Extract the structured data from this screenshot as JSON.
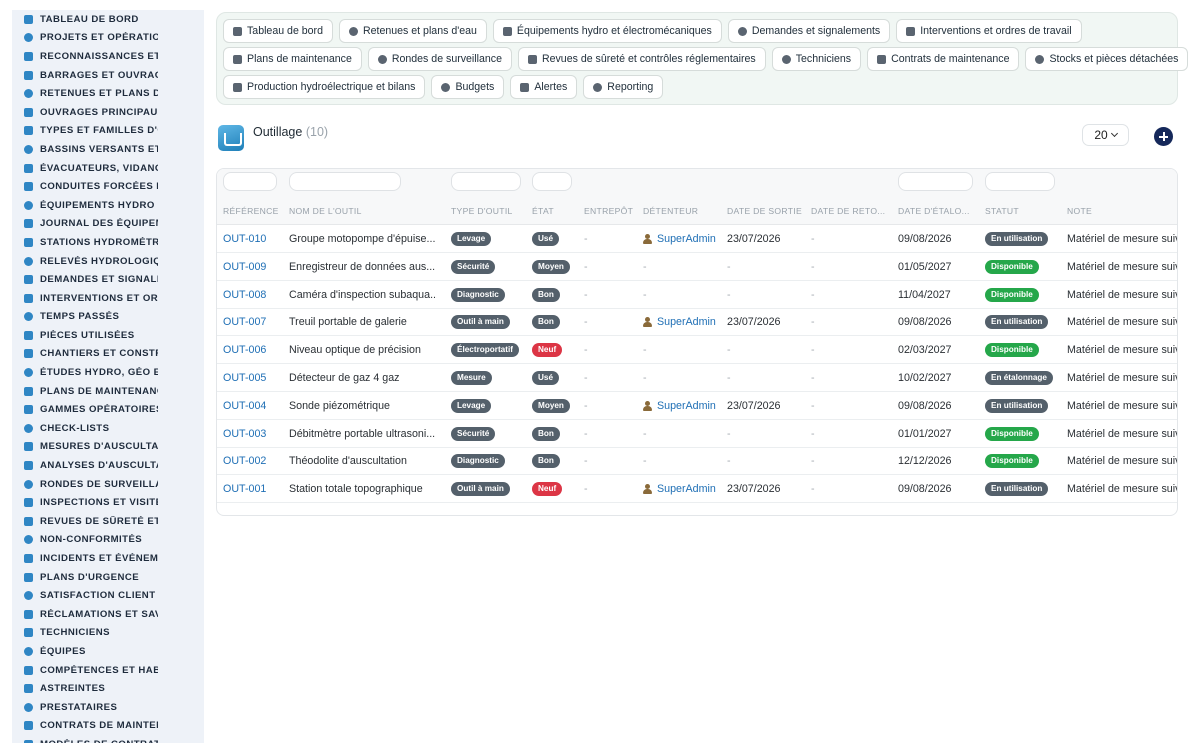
{
  "colors": {
    "sidebar_bg": "#eef2f8",
    "accent": "#2f86c4",
    "link": "#1f6fb5",
    "pill_dark": "#54606b",
    "pill_green": "#25a74a",
    "pill_red": "#dc3545",
    "add_button": "#15285a"
  },
  "sidebar": {
    "items": [
      {
        "label": "TABLEAU DE BORD",
        "icon": "dashboard-icon"
      },
      {
        "label": "PROJETS ET OPÉRATION",
        "icon": "target-icon"
      },
      {
        "label": "RECONNAISSANCES ET V",
        "icon": "ruler-icon"
      },
      {
        "label": "BARRAGES ET OUVRAGE",
        "icon": "dam-icon"
      },
      {
        "label": "RETENUES ET PLANS D'E",
        "icon": "document-icon"
      },
      {
        "label": "OUVRAGES PRINCIPAUX",
        "icon": "building-icon"
      },
      {
        "label": "TYPES ET FAMILLES D'OU",
        "icon": "sitemap-icon"
      },
      {
        "label": "BASSINS VERSANTS ET A",
        "icon": "grid-icon"
      },
      {
        "label": "ÉVACUATEURS, VIDANGE",
        "icon": "grid-icon"
      },
      {
        "label": "CONDUITES FORCÉES ET",
        "icon": "pipe-icon"
      },
      {
        "label": "ÉQUIPEMENTS HYDRO ET",
        "icon": "cogs-icon"
      },
      {
        "label": "JOURNAL DES ÉQUIPEME",
        "icon": "history-icon"
      },
      {
        "label": "STATIONS HYDROMÉTRIC",
        "icon": "gauge-icon"
      },
      {
        "label": "RELEVÉS HYDROLOGIQU",
        "icon": "table-icon"
      },
      {
        "label": "DEMANDES ET SIGNALEM",
        "icon": "help-icon"
      },
      {
        "label": "INTERVENTIONS ET ORDI",
        "icon": "clipboard-icon"
      },
      {
        "label": "TEMPS PASSÉS",
        "icon": "clock-icon"
      },
      {
        "label": "PIÈCES UTILISÉES",
        "icon": "boxes-icon"
      },
      {
        "label": "CHANTIERS ET CONSTRU",
        "icon": "hammer-icon"
      },
      {
        "label": "ÉTUDES HYDRO, GÉO ET",
        "icon": "book-icon"
      },
      {
        "label": "PLANS DE MAINTENANCE",
        "icon": "calendar-icon"
      },
      {
        "label": "GAMMES OPÉRATOIRES",
        "icon": "list-icon"
      },
      {
        "label": "CHECK-LISTS",
        "icon": "checklist-icon"
      },
      {
        "label": "MESURES D'AUSCULTATI",
        "icon": "file-icon"
      },
      {
        "label": "ANALYSES D'AUSCULTAT",
        "icon": "chart-icon"
      },
      {
        "label": "RONDES DE SURVEILLAN",
        "icon": "route-icon"
      },
      {
        "label": "INSPECTIONS ET VISITES",
        "icon": "search-icon"
      },
      {
        "label": "REVUES DE SÛRETÉ ET C",
        "icon": "clipboard-check-icon"
      },
      {
        "label": "NON-CONFORMITÉS",
        "icon": "alert-circle-icon"
      },
      {
        "label": "INCIDENTS ET ÉVÉNEMEI",
        "icon": "warning-icon"
      },
      {
        "label": "PLANS D'URGENCE",
        "icon": "edit-icon"
      },
      {
        "label": "SATISFACTION CLIENT",
        "icon": "smile-icon"
      },
      {
        "label": "RÉCLAMATIONS ET SAV",
        "icon": "comment-icon"
      },
      {
        "label": "TECHNICIENS",
        "icon": "hard-hat-icon"
      },
      {
        "label": "ÉQUIPES",
        "icon": "users-icon"
      },
      {
        "label": "COMPÉTENCES ET HABIL",
        "icon": "badge-icon"
      },
      {
        "label": "ASTREINTES",
        "icon": "phone-icon"
      },
      {
        "label": "PRESTATAIRES",
        "icon": "handshake-icon"
      },
      {
        "label": "CONTRATS DE MAINTENA",
        "icon": "contract-icon"
      },
      {
        "label": "MODÈLES DE CONTRATS",
        "icon": "template-icon"
      }
    ]
  },
  "topnav": {
    "rows": [
      [
        {
          "label": "Tableau de bord",
          "icon": "dashboard-icon"
        },
        {
          "label": "Retenues et plans d'eau",
          "icon": "building-icon"
        },
        {
          "label": "Équipements hydro et électromécaniques",
          "icon": "cogs-icon"
        },
        {
          "label": "Demandes et signalements",
          "icon": "help-icon"
        },
        {
          "label": "Interventions et ordres de travail",
          "icon": "clipboard-icon"
        }
      ],
      [
        {
          "label": "Plans de maintenance",
          "icon": "calendar-icon"
        },
        {
          "label": "Rondes de surveillance",
          "icon": "route-icon"
        },
        {
          "label": "Revues de sûreté et contrôles réglementaires",
          "icon": "clipboard-check-icon"
        },
        {
          "label": "Techniciens",
          "icon": "hard-hat-icon"
        },
        {
          "label": "Contrats de maintenance",
          "icon": "contract-icon"
        },
        {
          "label": "Stocks et pièces détachées",
          "icon": "boxes-icon"
        }
      ],
      [
        {
          "label": "Production hydroélectrique et bilans",
          "icon": "bolt-icon"
        },
        {
          "label": "Budgets",
          "icon": "money-icon"
        },
        {
          "label": "Alertes",
          "icon": "bell-icon"
        },
        {
          "label": "Reporting",
          "icon": "pie-chart-icon"
        }
      ]
    ]
  },
  "page": {
    "title": "Outillage",
    "count": "(10)",
    "page_size": "20"
  },
  "table": {
    "headers": [
      "RÉFÉRENCE",
      "NOM DE L'OUTIL",
      "TYPE D'OUTIL",
      "ÉTAT",
      "ENTREPÔT",
      "DÉTENTEUR",
      "DATE DE SORTIE",
      "DATE DE RETO...",
      "DATE D'ÉTALO...",
      "STATUT",
      "NOTE"
    ],
    "rows": [
      {
        "ref": "OUT-010",
        "name": "Groupe motopompe d'épuise...",
        "type": "Levage",
        "etat": "Usé",
        "entrepot": "-",
        "holder": "SuperAdmin",
        "sortie": "23/07/2026",
        "retour": "-",
        "etalonnage": "09/08/2026",
        "statut": "En utilisation",
        "note": "Matériel de mesure suivi"
      },
      {
        "ref": "OUT-009",
        "name": "Enregistreur de données aus...",
        "type": "Sécurité",
        "etat": "Moyen",
        "entrepot": "-",
        "holder": "-",
        "sortie": "-",
        "retour": "-",
        "etalonnage": "01/05/2027",
        "statut": "Disponible",
        "note": "Matériel de mesure suivi"
      },
      {
        "ref": "OUT-008",
        "name": "Caméra d'inspection subaqua...",
        "type": "Diagnostic",
        "etat": "Bon",
        "entrepot": "-",
        "holder": "-",
        "sortie": "-",
        "retour": "-",
        "etalonnage": "11/04/2027",
        "statut": "Disponible",
        "note": "Matériel de mesure suivi"
      },
      {
        "ref": "OUT-007",
        "name": "Treuil portable de galerie",
        "type": "Outil à main",
        "etat": "Bon",
        "entrepot": "-",
        "holder": "SuperAdmin",
        "sortie": "23/07/2026",
        "retour": "-",
        "etalonnage": "09/08/2026",
        "statut": "En utilisation",
        "note": "Matériel de mesure suivi"
      },
      {
        "ref": "OUT-006",
        "name": "Niveau optique de précision",
        "type": "Électroportatif",
        "etat": "Neuf",
        "entrepot": "-",
        "holder": "-",
        "sortie": "-",
        "retour": "-",
        "etalonnage": "02/03/2027",
        "statut": "Disponible",
        "note": "Matériel de mesure suivi"
      },
      {
        "ref": "OUT-005",
        "name": "Détecteur de gaz 4 gaz",
        "type": "Mesure",
        "etat": "Usé",
        "entrepot": "-",
        "holder": "-",
        "sortie": "-",
        "retour": "-",
        "etalonnage": "10/02/2027",
        "statut": "En étalonnage",
        "note": "Matériel de mesure suivi"
      },
      {
        "ref": "OUT-004",
        "name": "Sonde piézométrique",
        "type": "Levage",
        "etat": "Moyen",
        "entrepot": "-",
        "holder": "SuperAdmin",
        "sortie": "23/07/2026",
        "retour": "-",
        "etalonnage": "09/08/2026",
        "statut": "En utilisation",
        "note": "Matériel de mesure suivi"
      },
      {
        "ref": "OUT-003",
        "name": "Débitmètre portable ultrasoni...",
        "type": "Sécurité",
        "etat": "Bon",
        "entrepot": "-",
        "holder": "-",
        "sortie": "-",
        "retour": "-",
        "etalonnage": "01/01/2027",
        "statut": "Disponible",
        "note": "Matériel de mesure suivi"
      },
      {
        "ref": "OUT-002",
        "name": "Théodolite d'auscultation",
        "type": "Diagnostic",
        "etat": "Bon",
        "entrepot": "-",
        "holder": "-",
        "sortie": "-",
        "retour": "-",
        "etalonnage": "12/12/2026",
        "statut": "Disponible",
        "note": "Matériel de mesure suivi"
      },
      {
        "ref": "OUT-001",
        "name": "Station totale topographique",
        "type": "Outil à main",
        "etat": "Neuf",
        "entrepot": "-",
        "holder": "SuperAdmin",
        "sortie": "23/07/2026",
        "retour": "-",
        "etalonnage": "09/08/2026",
        "statut": "En utilisation",
        "note": "Matériel de mesure suivi"
      }
    ]
  }
}
